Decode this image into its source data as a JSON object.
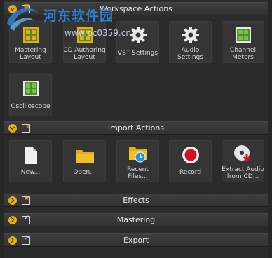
{
  "sections": {
    "workspace": {
      "title": "Workspace Actions",
      "tiles": [
        {
          "label": "Mastering\nLayout",
          "icon": "layout-grid-icon"
        },
        {
          "label": "CD Authoring\nLayout",
          "icon": "layout-grid-icon"
        },
        {
          "label": "VST Settings",
          "icon": "gear-icon"
        },
        {
          "label": "Audio\nSettings",
          "icon": "gear-icon"
        },
        {
          "label": "Channel\nMeters",
          "icon": "meters-icon"
        },
        {
          "label": "Oscilloscope",
          "icon": "scope-icon"
        }
      ]
    },
    "import": {
      "title": "Import Actions",
      "tiles": [
        {
          "label": "New...",
          "icon": "new-file-icon"
        },
        {
          "label": "Open...",
          "icon": "folder-icon"
        },
        {
          "label": "Recent\nFiles...",
          "icon": "recent-folder-icon"
        },
        {
          "label": "Record",
          "icon": "record-icon"
        },
        {
          "label": "Extract Audio\nfrom CD...",
          "icon": "cd-extract-icon"
        }
      ]
    },
    "effects": {
      "title": "Effects"
    },
    "mastering": {
      "title": "Mastering"
    },
    "export": {
      "title": "Export"
    }
  },
  "watermark": {
    "text": "河东软件园",
    "url": "www.pc0359.cn"
  },
  "colors": {
    "accent": "#e2ac1a",
    "panel": "#2b2b2b",
    "tile": "#353535",
    "record_red": "#d4111e"
  }
}
